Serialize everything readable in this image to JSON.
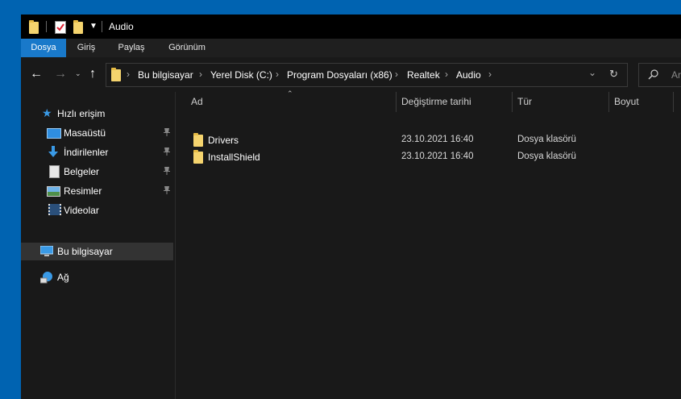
{
  "window": {
    "title": "Audio"
  },
  "quick_access": {
    "icons": [
      "folder-icon",
      "properties-icon",
      "new-folder-icon",
      "customize-dropdown-icon"
    ]
  },
  "ribbon": {
    "tabs": [
      {
        "label": "Dosya",
        "active": true
      },
      {
        "label": "Giriş",
        "active": false
      },
      {
        "label": "Paylaş",
        "active": false
      },
      {
        "label": "Görünüm",
        "active": false
      }
    ]
  },
  "address_bar": {
    "breadcrumbs": [
      "Bu bilgisayar",
      "Yerel Disk (C:)",
      "Program Dosyaları (x86)",
      "Realtek",
      "Audio"
    ]
  },
  "search": {
    "placeholder": "Ar"
  },
  "sidebar": {
    "quick_access_label": "Hızlı erişim",
    "items": [
      {
        "label": "Masaüstü",
        "icon": "desktop-icon",
        "pinned": true
      },
      {
        "label": "İndirilenler",
        "icon": "download-icon",
        "pinned": true
      },
      {
        "label": "Belgeler",
        "icon": "documents-icon",
        "pinned": true
      },
      {
        "label": "Resimler",
        "icon": "pictures-icon",
        "pinned": true
      },
      {
        "label": "Videolar",
        "icon": "videos-icon",
        "pinned": false
      }
    ],
    "this_pc_label": "Bu bilgisayar",
    "network_label": "Ağ"
  },
  "file_list": {
    "columns": [
      "Ad",
      "Değiştirme tarihi",
      "Tür",
      "Boyut"
    ],
    "rows": [
      {
        "name": "Drivers",
        "modified": "23.10.2021 16:40",
        "type": "Dosya klasörü",
        "size": ""
      },
      {
        "name": "InstallShield",
        "modified": "23.10.2021 16:40",
        "type": "Dosya klasörü",
        "size": ""
      }
    ]
  },
  "colors": {
    "accent": "#1979ca",
    "desktop": "#0063b1",
    "folder": "#f5d46e",
    "background": "#191919"
  }
}
